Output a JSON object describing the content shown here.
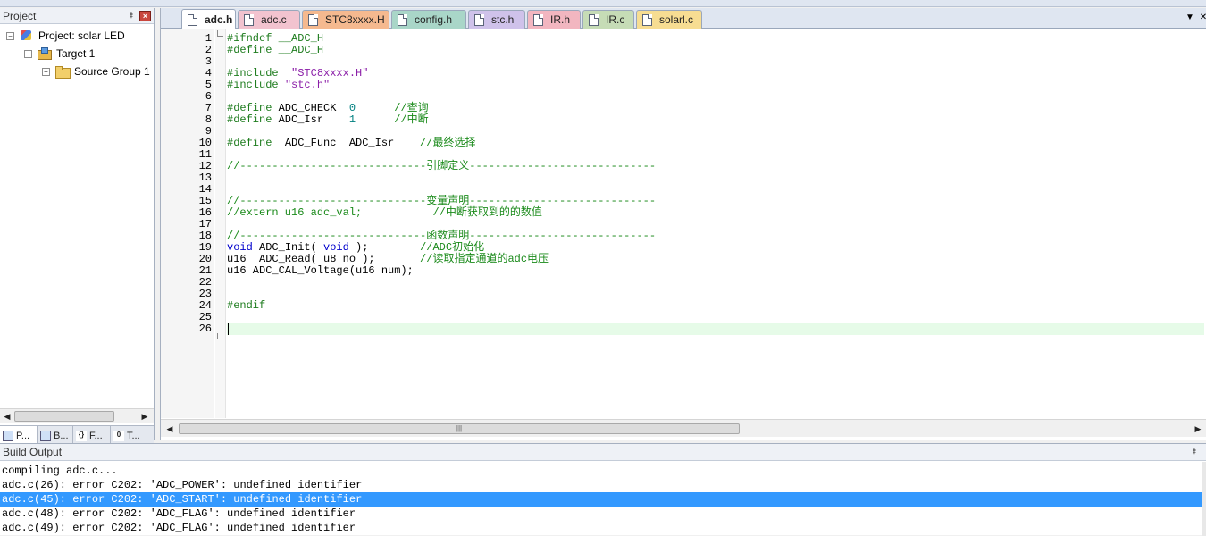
{
  "project_pane": {
    "title": "Project",
    "tree": [
      {
        "label": "Project: solar LED",
        "expander": "−",
        "icon": "project-icon",
        "level": 0
      },
      {
        "label": "Target 1",
        "expander": "−",
        "icon": "target-icon",
        "level": 1
      },
      {
        "label": "Source Group 1",
        "expander": "+",
        "icon": "folder-icon",
        "level": 2
      }
    ],
    "tabs": [
      {
        "label": "P...",
        "glyph": ""
      },
      {
        "label": "B...",
        "glyph": ""
      },
      {
        "label": "F...",
        "glyph": "{}"
      },
      {
        "label": "T...",
        "glyph": "0"
      }
    ]
  },
  "editor": {
    "tabs": [
      {
        "label": "adc.h",
        "color": "#ffffff",
        "active": true
      },
      {
        "label": "adc.c",
        "color": "#f2c3cf"
      },
      {
        "label": "STC8xxxx.H",
        "color": "#f5b98f"
      },
      {
        "label": "config.h",
        "color": "#a9d6c8"
      },
      {
        "label": "stc.h",
        "color": "#cfc2ea"
      },
      {
        "label": "IR.h",
        "color": "#f2b6c0"
      },
      {
        "label": "IR.c",
        "color": "#c6dcb6"
      },
      {
        "label": "solarl.c",
        "color": "#f7dd92"
      }
    ],
    "line_numbers": [
      "1",
      "2",
      "3",
      "4",
      "5",
      "6",
      "7",
      "8",
      "9",
      "10",
      "11",
      "12",
      "13",
      "14",
      "15",
      "16",
      "17",
      "18",
      "19",
      "20",
      "21",
      "22",
      "23",
      "24",
      "25",
      "26"
    ],
    "current_line": 26,
    "lines": [
      [
        {
          "t": "#ifndef __ADC_H",
          "c": "pre"
        }
      ],
      [
        {
          "t": "#define __ADC_H",
          "c": "pre"
        }
      ],
      [],
      [
        {
          "t": "#include  ",
          "c": "pre"
        },
        {
          "t": "\"STC8xxxx.H\"",
          "c": "str"
        }
      ],
      [
        {
          "t": "#include ",
          "c": "pre"
        },
        {
          "t": "\"stc.h\"",
          "c": "str"
        }
      ],
      [],
      [
        {
          "t": "#define ",
          "c": "pre"
        },
        {
          "t": "ADC_CHECK  ",
          "c": "plain"
        },
        {
          "t": "0",
          "c": "num"
        },
        {
          "t": "      ",
          "c": "plain"
        },
        {
          "t": "//查询",
          "c": "com"
        }
      ],
      [
        {
          "t": "#define ",
          "c": "pre"
        },
        {
          "t": "ADC_Isr    ",
          "c": "plain"
        },
        {
          "t": "1",
          "c": "num"
        },
        {
          "t": "      ",
          "c": "plain"
        },
        {
          "t": "//中断",
          "c": "com"
        }
      ],
      [],
      [
        {
          "t": "#define  ",
          "c": "pre"
        },
        {
          "t": "ADC_Func  ADC_Isr    ",
          "c": "plain"
        },
        {
          "t": "//最终选择",
          "c": "com"
        }
      ],
      [],
      [
        {
          "t": "//-----------------------------引脚定义-----------------------------",
          "c": "com"
        }
      ],
      [],
      [],
      [
        {
          "t": "//-----------------------------变量声明-----------------------------",
          "c": "com"
        }
      ],
      [
        {
          "t": "//extern u16 adc_val;           //中断获取到的的数值",
          "c": "com"
        }
      ],
      [],
      [
        {
          "t": "//-----------------------------函数声明-----------------------------",
          "c": "com"
        }
      ],
      [
        {
          "t": "void ",
          "c": "kw"
        },
        {
          "t": "ADC_Init( ",
          "c": "plain"
        },
        {
          "t": "void",
          "c": "kw"
        },
        {
          "t": " );        ",
          "c": "plain"
        },
        {
          "t": "//ADC初始化",
          "c": "com"
        }
      ],
      [
        {
          "t": "u16  ADC_Read( u8 no );       ",
          "c": "plain"
        },
        {
          "t": "//读取指定通道的adc电压",
          "c": "com"
        }
      ],
      [
        {
          "t": "u16 ADC_CAL_Voltage(u16 num);",
          "c": "plain"
        }
      ],
      [],
      [],
      [
        {
          "t": "#endif",
          "c": "pre"
        }
      ],
      [],
      []
    ]
  },
  "build_output": {
    "title": "Build Output",
    "lines": [
      {
        "text": "compiling adc.c...",
        "selected": false
      },
      {
        "text": "adc.c(26): error C202: 'ADC_POWER': undefined identifier",
        "selected": false
      },
      {
        "text": "adc.c(45): error C202: 'ADC_START': undefined identifier",
        "selected": true
      },
      {
        "text": "adc.c(48): error C202: 'ADC_FLAG': undefined identifier",
        "selected": false
      },
      {
        "text": "adc.c(49): error C202: 'ADC_FLAG': undefined identifier",
        "selected": false
      }
    ]
  }
}
